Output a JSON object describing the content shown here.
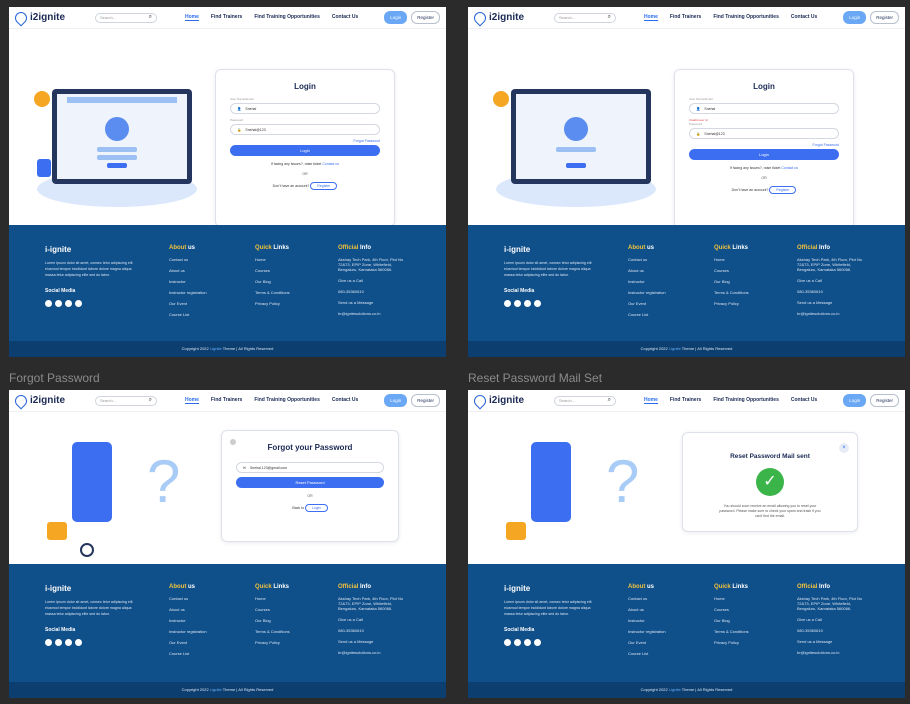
{
  "frames": {
    "f3_label": "Forgot Password",
    "f4_label": "Reset Password Mail Set"
  },
  "nav": {
    "logo": "i2ignite",
    "search_placeholder": "Search...",
    "links": [
      "Home",
      "Find Trainers",
      "Find Training Opportunities",
      "Contact Us"
    ],
    "login": "Login",
    "register": "Register"
  },
  "login_card": {
    "title": "Login",
    "email_label": "User Name/Email",
    "email_value": "Snehal",
    "error": "Invalid user id",
    "password_label": "Password",
    "password_value": "Snehal@123",
    "forgot": "Forgot Password",
    "button": "Login",
    "issue_text": "If facing any issues?, raise ticket",
    "contact": "Contact us",
    "or": "OR",
    "no_account": "Don't have an account?",
    "register": "Register"
  },
  "forgot_card": {
    "title": "Forgot your Password",
    "email_value": "Snehal.123@gmail.com",
    "button": "Reset Password",
    "or": "OR",
    "back": "Back to",
    "login": "Login"
  },
  "mail_card": {
    "title": "Reset Password Mail sent",
    "text": "You should soon receive an email allowing you to reset your password. Please make sure to check your spam and trash if you can't find the email."
  },
  "footer": {
    "brand": "i-ignite",
    "about_text": "Lorem ipsum dolor sit amet, consec tetur adipiscing elit eiusmod tempor incididunt labore dolore magna aliqua massa tetur adipiscing elite sed do labor.",
    "social": "Social Media",
    "about_title": [
      "About ",
      "us"
    ],
    "about_items": [
      "Contact us",
      "About us",
      "Instructor",
      "Instructor registration",
      "Our Event",
      "Course List"
    ],
    "quick_title": [
      "Quick ",
      "Links"
    ],
    "quick_items": [
      "Home",
      "Courses",
      "Our Blog",
      "Terms & Conditions",
      "Privacy Policy"
    ],
    "info_title": [
      "Official ",
      "Info"
    ],
    "address": "Akshay Tech Park, 4th Floor, Plot No 72&73, EPIP Zone, Whitefield, Bengaluru, Karnataka 560066.",
    "call_label": "Give us a Call",
    "phone": "080-35360610",
    "mail_label": "Send us a Message",
    "email": "hr@ignitesolutions.co.in",
    "copyright_a": "Copyright 2022",
    "copyright_b": "i-ignite",
    "copyright_c": "Theme | All Rights Reserved"
  }
}
